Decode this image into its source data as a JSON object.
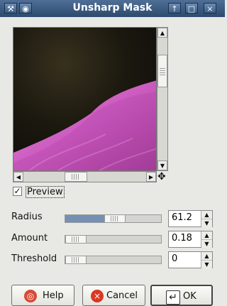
{
  "window": {
    "title": "Unsharp Mask",
    "icon": "app-icon",
    "buttons": [
      "menu-icon",
      "raise-icon",
      "maximize-icon",
      "close-icon"
    ]
  },
  "preview": {
    "label": "Preview",
    "checked": true,
    "image_description_icon": "preview-image"
  },
  "controls": [
    {
      "label": "Radius",
      "value": "61.2",
      "slider_fraction": 0.4
    },
    {
      "label": "Amount",
      "value": "0.18",
      "slider_fraction": 0.0
    },
    {
      "label": "Threshold",
      "value": "0",
      "slider_fraction": 0.0
    }
  ],
  "buttons": {
    "help": "Help",
    "cancel": "Cancel",
    "ok": "OK"
  },
  "colors": {
    "title_bar": "#2c4a6d",
    "slider_fill": "#7590b3",
    "dialog_bg": "#e8e8e4"
  }
}
